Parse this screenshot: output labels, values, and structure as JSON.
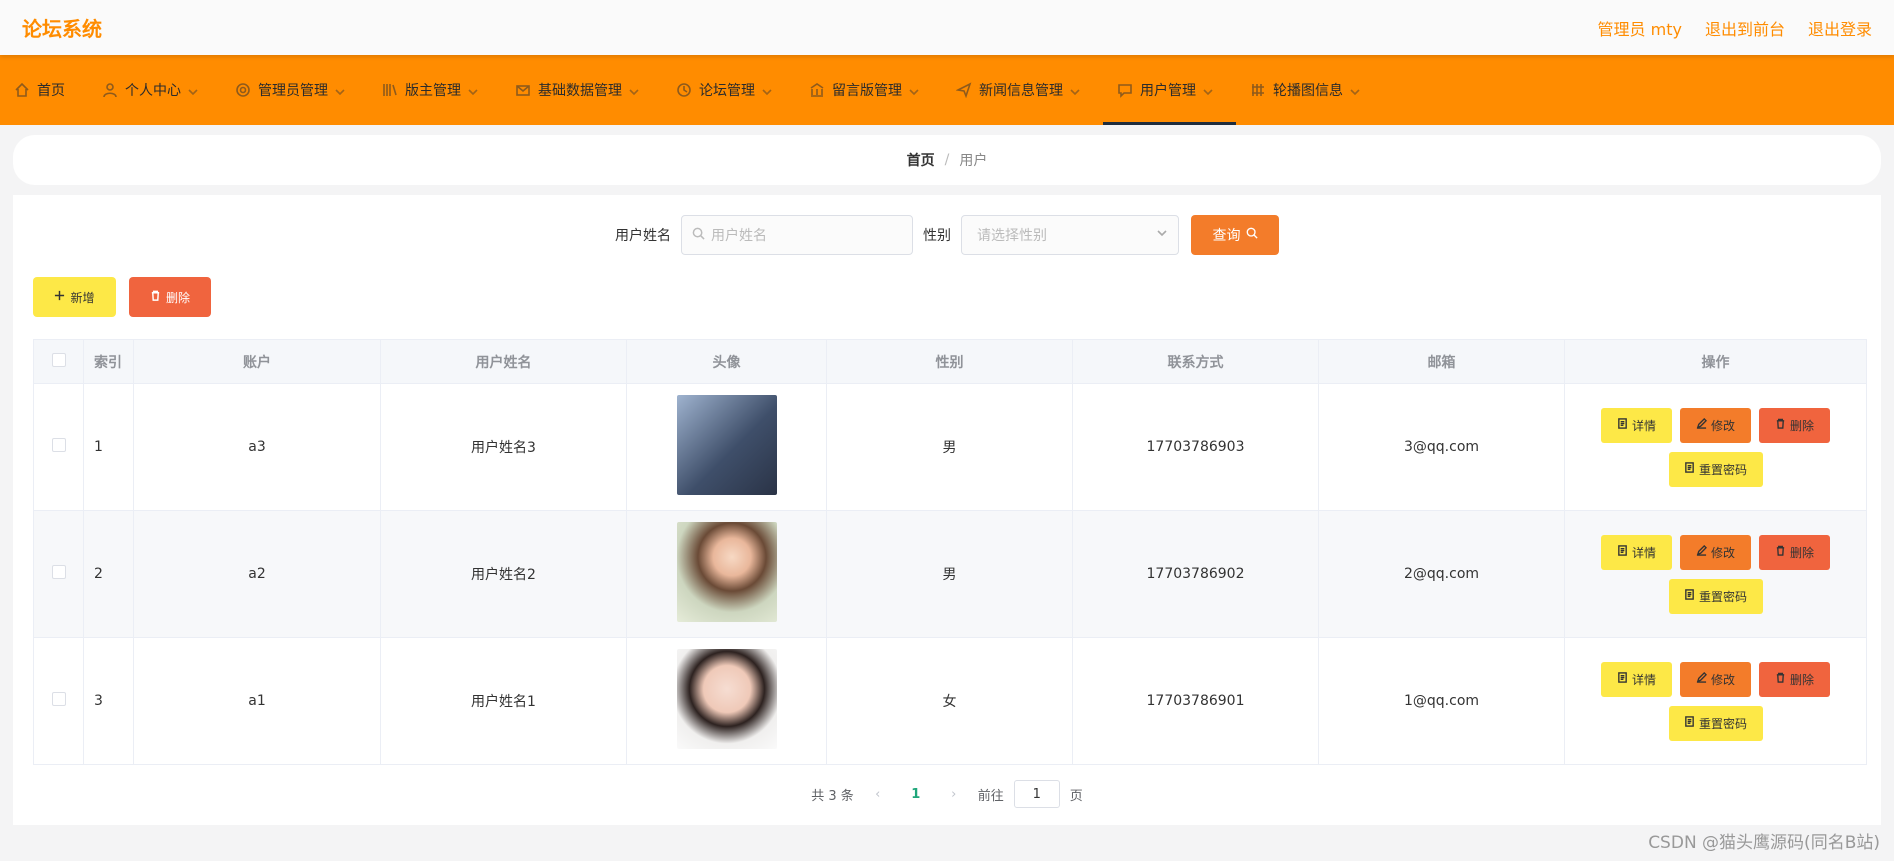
{
  "header": {
    "brand": "论坛系统",
    "admin_label": "管理员 mty",
    "back_label": "退出到前台",
    "logout_label": "退出登录"
  },
  "nav": {
    "items": [
      {
        "label": "首页",
        "icon": "home-icon"
      },
      {
        "label": "个人中心",
        "icon": "user-icon"
      },
      {
        "label": "管理员管理",
        "icon": "at-icon"
      },
      {
        "label": "版主管理",
        "icon": "library-icon"
      },
      {
        "label": "基础数据管理",
        "icon": "mail-icon"
      },
      {
        "label": "论坛管理",
        "icon": "clock-icon"
      },
      {
        "label": "留言版管理",
        "icon": "bank-icon"
      },
      {
        "label": "新闻信息管理",
        "icon": "send-icon"
      },
      {
        "label": "用户管理",
        "icon": "chat-icon"
      },
      {
        "label": "轮播图信息",
        "icon": "grid-icon"
      }
    ],
    "active_index": 8
  },
  "breadcrumb": {
    "home": "首页",
    "separator": "/",
    "current": "用户"
  },
  "search": {
    "name_label": "用户姓名",
    "name_placeholder": "用户姓名",
    "gender_label": "性别",
    "gender_placeholder": "请选择性别",
    "query_label": "查询"
  },
  "actions": {
    "add_label": "新增",
    "delete_label": "删除"
  },
  "table": {
    "headers": [
      "索引",
      "账户",
      "用户姓名",
      "头像",
      "性别",
      "联系方式",
      "邮箱",
      "操作"
    ],
    "rows": [
      {
        "index": "1",
        "account": "a3",
        "name": "用户姓名3",
        "avatar": "avatar-image",
        "gender": "男",
        "phone": "17703786903",
        "email": "3@qq.com"
      },
      {
        "index": "2",
        "account": "a2",
        "name": "用户姓名2",
        "avatar": "avatar-image",
        "gender": "男",
        "phone": "17703786902",
        "email": "2@qq.com"
      },
      {
        "index": "3",
        "account": "a1",
        "name": "用户姓名1",
        "avatar": "avatar-image",
        "gender": "女",
        "phone": "17703786901",
        "email": "1@qq.com"
      }
    ],
    "row_ops": {
      "detail": "详情",
      "edit": "修改",
      "delete": "删除",
      "reset": "重置密码"
    }
  },
  "pagination": {
    "total_text": "共 3 条",
    "current_page": "1",
    "goto_prefix": "前往",
    "goto_value": "1",
    "goto_suffix": "页"
  },
  "watermark": "CSDN @猫头鹰源码(同名B站)",
  "colors": {
    "primary": "#ff8c00",
    "query": "#f37c2a",
    "add": "#fde847",
    "danger": "#f0643e",
    "page_active": "#1fa67a"
  }
}
